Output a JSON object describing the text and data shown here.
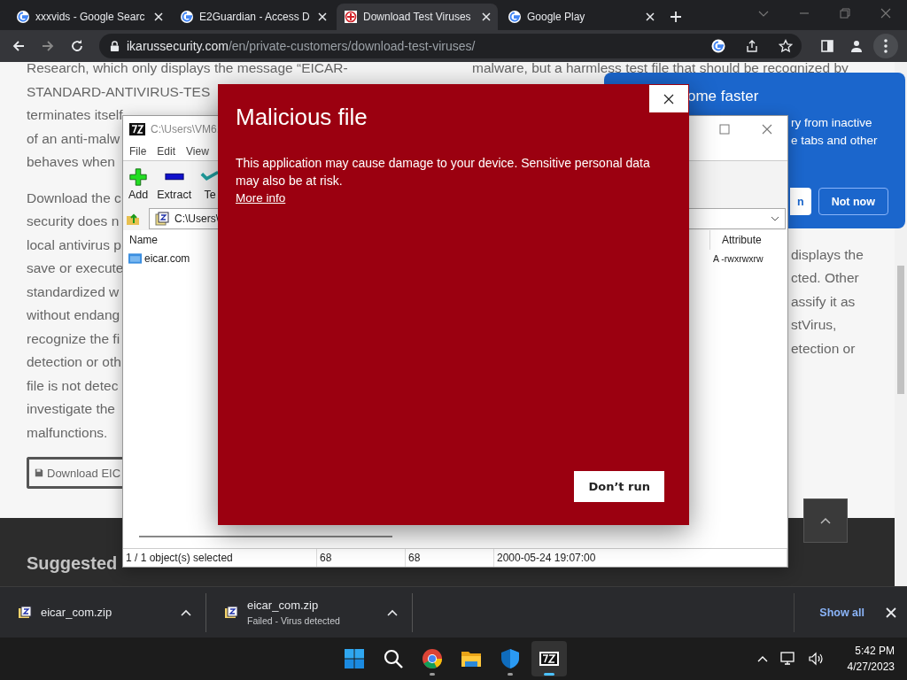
{
  "browser": {
    "tabs": [
      {
        "title": "xxxvids - Google Searc",
        "kind": "g-logo",
        "selected": false
      },
      {
        "title": "E2Guardian - Access D",
        "kind": "g-logo",
        "selected": false
      },
      {
        "title": "Download Test Viruses",
        "kind": "cross",
        "selected": true
      },
      {
        "title": "Google Play",
        "kind": "g-logo",
        "selected": false
      }
    ],
    "address": {
      "domain": "ikarussecurity.com",
      "path": "/en/private-customers/download-test-viruses/"
    }
  },
  "page": {
    "left_paragraphs": [
      [
        "Research, which only displays the message “EICAR-",
        "STANDARD-ANTIVIRUS-TES",
        "terminates itself",
        "of an anti-malw",
        "behaves when"
      ],
      [
        "Download the c",
        "security does n",
        "local antivirus p",
        "save or execute",
        "standardized w",
        "without endang",
        "recognize the fi",
        "detection or oth",
        "file is not detec",
        "investigate the",
        "malfunctions."
      ]
    ],
    "download_button": "Download EIC",
    "right_top_line": "malware, but a harmless test file that should be recognized by",
    "right_lines": [
      "displays the",
      "cted. Other",
      "assify it as",
      "stVirus,",
      "etection or"
    ],
    "footer_heading": "Suggested"
  },
  "chrome_popup": {
    "title": "ome faster",
    "lines": [
      "ry from inactive",
      "e tabs and other"
    ],
    "buttons": [
      {
        "label": "n",
        "kind": "primary"
      },
      {
        "label": "Not now",
        "kind": "outline"
      }
    ]
  },
  "archive_window": {
    "title": "C:\\Users\\VM6.",
    "menu": [
      "File",
      "Edit",
      "View"
    ],
    "toolbar": [
      {
        "label": "Add",
        "kind": "add"
      },
      {
        "label": "Extract",
        "kind": "extract"
      },
      {
        "label": "Te",
        "kind": "test"
      }
    ],
    "path": "C:\\Users\\",
    "columns": [
      "Name",
      "Attribute"
    ],
    "rows": [
      {
        "name": "eicar.com",
        "attribute": "A -rwxrwxrw"
      }
    ],
    "status": [
      "1 / 1 object(s) selected",
      "68",
      "68",
      "2000-05-24 19:07:00"
    ]
  },
  "alert": {
    "title": "Malicious file",
    "message": "This application may cause damage to your device. Sensitive personal data may also be at risk.",
    "link": "More info",
    "button": "Don’t run"
  },
  "downloads": {
    "items": [
      {
        "name": "eicar_com.zip"
      },
      {
        "name": "eicar_com.zip",
        "status": "Failed - Virus detected"
      }
    ],
    "show_all": "Show all"
  },
  "taskbar": {
    "apps": [
      {
        "kind": "start",
        "running": false,
        "selected": false
      },
      {
        "kind": "search",
        "running": false,
        "selected": false
      },
      {
        "kind": "chrome",
        "running": true,
        "selected": false
      },
      {
        "kind": "folder",
        "running": false,
        "selected": false
      },
      {
        "kind": "shield",
        "running": true,
        "selected": false
      },
      {
        "kind": "archiver",
        "running": true,
        "selected": true
      }
    ],
    "time": "5:42 PM",
    "date": "4/27/2023"
  }
}
